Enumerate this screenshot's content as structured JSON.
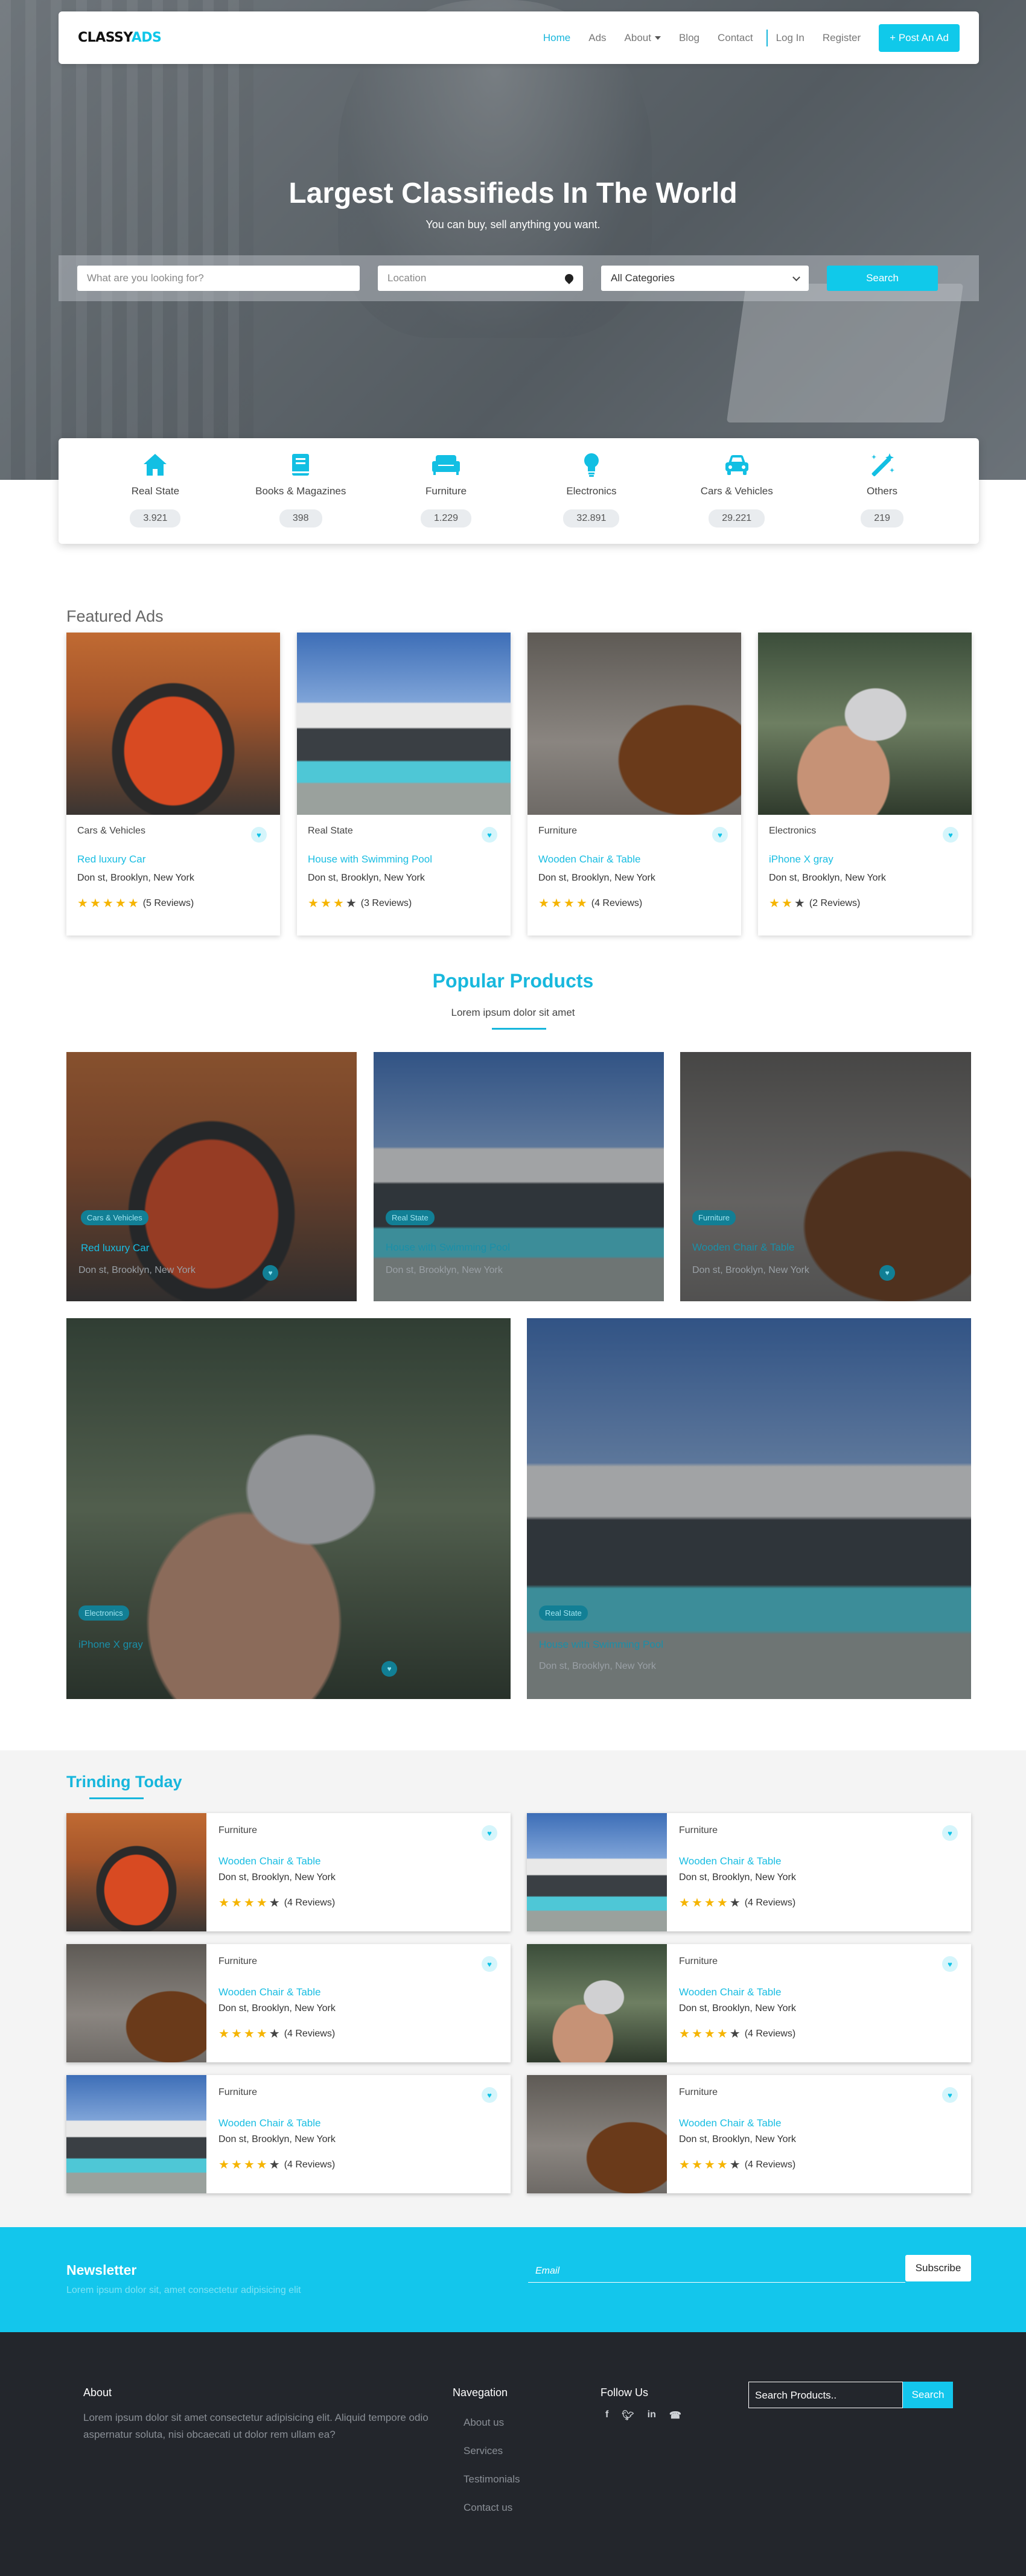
{
  "brand": {
    "part1": "CLASSY",
    "part2": "ADS"
  },
  "nav": {
    "home": "Home",
    "ads": "Ads",
    "about": "About",
    "blog": "Blog",
    "contact": "Contact",
    "login": "Log In",
    "register": "Register",
    "post_ad": "+ Post An Ad"
  },
  "hero": {
    "title": "Largest Classifieds In The World",
    "subtitle": "You can buy, sell anything you want."
  },
  "search": {
    "query_placeholder": "What are you looking for?",
    "location_placeholder": "Location",
    "category": "All Categories",
    "button": "Search"
  },
  "categories": [
    {
      "label": "Real State",
      "count": "3.921",
      "icon": "home-icon"
    },
    {
      "label": "Books & Magazines",
      "count": "398",
      "icon": "book-icon"
    },
    {
      "label": "Furniture",
      "count": "1.229",
      "icon": "couch-icon"
    },
    {
      "label": "Electronics",
      "count": "32.891",
      "icon": "lightbulb-icon"
    },
    {
      "label": "Cars & Vehicles",
      "count": "29.221",
      "icon": "car-icon"
    },
    {
      "label": "Others",
      "count": "219",
      "icon": "magic-wand-icon"
    }
  ],
  "featured": {
    "title": "Featured Ads",
    "items": [
      {
        "category": "Cars & Vehicles",
        "title": "Red luxury Car",
        "address": "Don st, Brooklyn, New York",
        "stars": 5,
        "reviews": "(5 Reviews)"
      },
      {
        "category": "Real State",
        "title": "House with Swimming Pool",
        "address": "Don st, Brooklyn, New York",
        "stars": 3,
        "reviews": "(3 Reviews)"
      },
      {
        "category": "Furniture",
        "title": "Wooden Chair & Table",
        "address": "Don st, Brooklyn, New York",
        "stars": 4,
        "reviews": "(4 Reviews)"
      },
      {
        "category": "Electronics",
        "title": "iPhone X gray",
        "address": "Don st, Brooklyn, New York",
        "stars": 2,
        "reviews": "(2 Reviews)"
      }
    ]
  },
  "popular": {
    "title": "Popular Products",
    "subtitle": "Lorem ipsum dolor sit amet",
    "items": [
      {
        "badge": "Cars & Vehicles",
        "title": "Red luxury Car",
        "address": "Don st, Brooklyn, New York"
      },
      {
        "badge": "Real State",
        "title": "House with Swimming Pool",
        "address": "Don st, Brooklyn, New York"
      },
      {
        "badge": "Furniture",
        "title": "Wooden Chair & Table",
        "address": "Don st, Brooklyn, New York"
      },
      {
        "badge": "Electronics",
        "title": "iPhone X gray",
        "address": ""
      },
      {
        "badge": "Real State",
        "title": "House with Swimming Pool",
        "address": "Don st, Brooklyn, New York"
      }
    ]
  },
  "trending": {
    "title": "Trinding Today",
    "items": [
      {
        "category": "Furniture",
        "title": "Wooden Chair & Table",
        "address": "Don st, Brooklyn, New York",
        "reviews": "(4 Reviews)"
      },
      {
        "category": "Furniture",
        "title": "Wooden Chair & Table",
        "address": "Don st, Brooklyn, New York",
        "reviews": "(4 Reviews)"
      },
      {
        "category": "Furniture",
        "title": "Wooden Chair & Table",
        "address": "Don st, Brooklyn, New York",
        "reviews": "(4 Reviews)"
      },
      {
        "category": "Furniture",
        "title": "Wooden Chair & Table",
        "address": "Don st, Brooklyn, New York",
        "reviews": "(4 Reviews)"
      },
      {
        "category": "Furniture",
        "title": "Wooden Chair & Table",
        "address": "Don st, Brooklyn, New York",
        "reviews": "(4 Reviews)"
      },
      {
        "category": "Furniture",
        "title": "Wooden Chair & Table",
        "address": "Don st, Brooklyn, New York",
        "reviews": "(4 Reviews)"
      }
    ]
  },
  "newsletter": {
    "title": "Newsletter",
    "subtitle": "Lorem ipsum dolor sit, amet consectetur adipisicing elit",
    "email_placeholder": "Email",
    "button": "Subscribe"
  },
  "footer": {
    "about_title": "About",
    "about_text": "Lorem ipsum dolor sit amet consectetur adipisicing elit. Aliquid tempore odio aspernatur soluta, nisi obcaecati ut dolor rem ullam ea?",
    "nav_title": "Navegation",
    "nav_links": [
      "About us",
      "Services",
      "Testimonials",
      "Contact us"
    ],
    "follow_title": "Follow Us",
    "social": [
      "facebook-icon",
      "twitter-icon",
      "linkedin-icon",
      "phone-icon"
    ],
    "search_placeholder": "Search Products..",
    "search_button": "Search"
  },
  "colors": {
    "accent": "#10c9ea",
    "link": "#18bde2",
    "star": "#f5b400",
    "footer_bg": "#23262c"
  }
}
